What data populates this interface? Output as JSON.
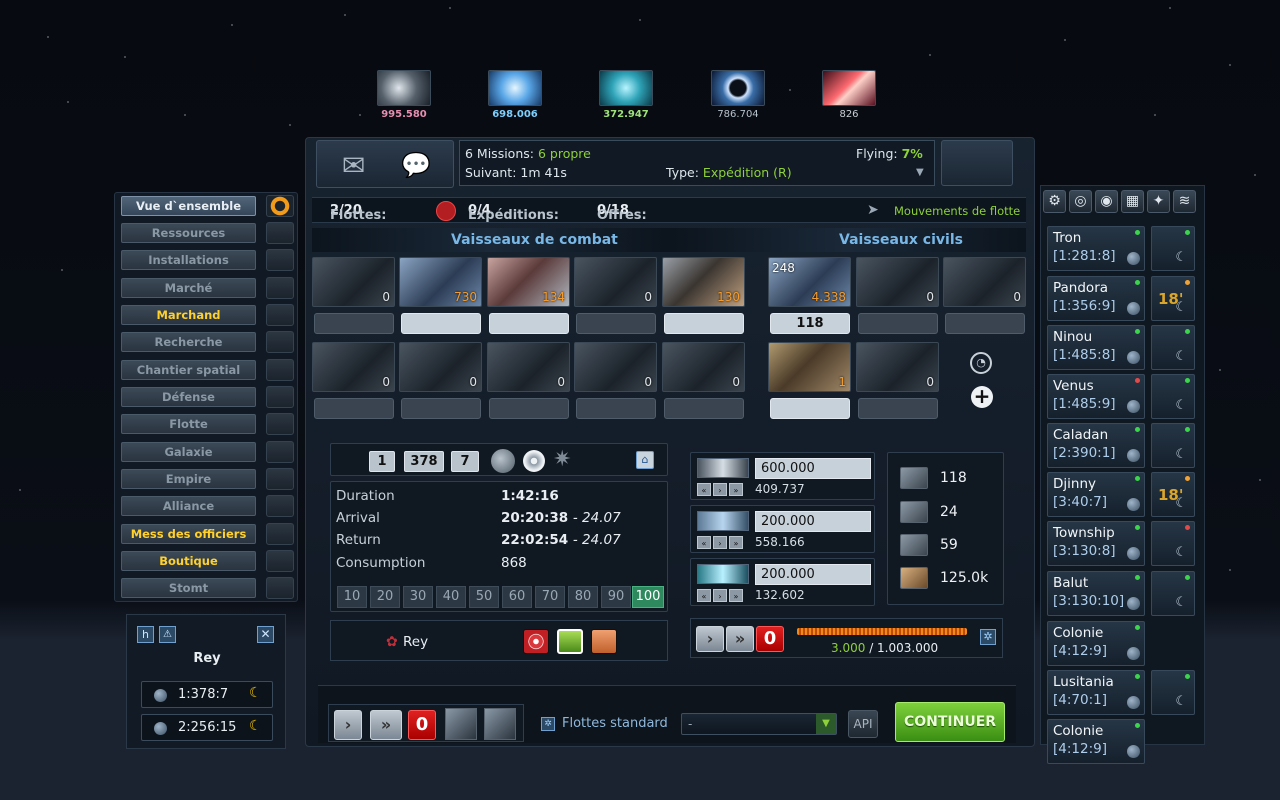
{
  "resources": [
    {
      "icon": "metal-resource-icon",
      "value": "995.580",
      "color": "#e78fb0"
    },
    {
      "icon": "crystal-resource-icon",
      "value": "698.006",
      "color": "#7ed0ff"
    },
    {
      "icon": "deuterium-resource-icon",
      "value": "372.947",
      "color": "#9fe27a"
    },
    {
      "icon": "energy-resource-icon",
      "value": "786.704",
      "color": "#b8c2cc"
    },
    {
      "icon": "dark-matter-resource-icon",
      "value": "826",
      "color": "#c8cfd6"
    }
  ],
  "mission": {
    "count": "6 Missions:",
    "own": "6 propre",
    "next_label": "Suivant:",
    "next_value": "1m 41s",
    "flying_label": "Flying:",
    "flying_value": "7%",
    "type_label": "Type:",
    "type_value": "Expédition (R)"
  },
  "fleetbar": {
    "fleets_label": "Flottes:",
    "fleets_value": "2/20",
    "exp_label": "Expéditions:",
    "exp_value": "0/4",
    "offers_label": "Offres:",
    "offers_value": "0/18",
    "movements": "Mouvements de flotte"
  },
  "menu": [
    {
      "label": "Vue d`ensemble"
    },
    {
      "label": "Ressources"
    },
    {
      "label": "Installations"
    },
    {
      "label": "Marché"
    },
    {
      "label": "Marchand"
    },
    {
      "label": "Recherche"
    },
    {
      "label": "Chantier spatial"
    },
    {
      "label": "Défense"
    },
    {
      "label": "Flotte"
    },
    {
      "label": "Galaxie"
    },
    {
      "label": "Empire"
    },
    {
      "label": "Alliance"
    },
    {
      "label": "Mess des officiers"
    },
    {
      "label": "Boutique"
    },
    {
      "label": "Stomt"
    }
  ],
  "sections": {
    "combat": "Vaisseaux de combat",
    "civil": "Vaisseaux civils"
  },
  "combat_ships": [
    {
      "count": "0",
      "input": ""
    },
    {
      "count": "730",
      "input": ""
    },
    {
      "count": "134",
      "input": ""
    },
    {
      "count": "0",
      "input": ""
    },
    {
      "count": "130",
      "input": ""
    },
    {
      "count": "0",
      "input": ""
    },
    {
      "count": "0",
      "input": ""
    },
    {
      "count": "0",
      "input": ""
    },
    {
      "count": "0",
      "input": ""
    },
    {
      "count": "0",
      "input": ""
    }
  ],
  "civil_ships": [
    {
      "count": "4.338",
      "corner": "248",
      "input": "118"
    },
    {
      "count": "0",
      "input": ""
    },
    {
      "count": "0",
      "input": ""
    },
    {
      "count": "1",
      "input": ""
    },
    {
      "count": "0",
      "input": ""
    }
  ],
  "coords": {
    "galaxy": "1",
    "system": "378",
    "position": "7"
  },
  "info": {
    "duration_label": "Duration",
    "duration_value": "1:42:16",
    "arrival_label": "Arrival",
    "arrival_time": "20:20:38",
    "arrival_date": "24.07",
    "return_label": "Return",
    "return_time": "22:02:54",
    "return_date": "24.07",
    "consumption_label": "Consumption",
    "consumption_value": "868"
  },
  "speeds": [
    "10",
    "20",
    "30",
    "40",
    "50",
    "60",
    "70",
    "80",
    "90",
    "100"
  ],
  "target_player": "Rey",
  "cargo": [
    {
      "value": "600.000",
      "rest": "409.737"
    },
    {
      "value": "200.000",
      "rest": "558.166"
    },
    {
      "value": "200.000",
      "rest": "132.602"
    }
  ],
  "stock": [
    "118",
    "24",
    "59",
    "125.0k"
  ],
  "load": {
    "used": "3.000",
    "total": "/ 1.003.000"
  },
  "bottom": {
    "standard": "Flottes standard",
    "select": "-",
    "api": "API",
    "continue": "CONTINUER"
  },
  "left_box": {
    "h": "h",
    "name": "Rey",
    "planets": [
      "1:378:7",
      "2:256:15"
    ]
  },
  "planets": [
    {
      "name": "Tron",
      "coord": "[1:281:8]",
      "dot": "g",
      "moon": true,
      "timer": ""
    },
    {
      "name": "Pandora",
      "coord": "[1:356:9]",
      "dot": "g",
      "moon": true,
      "timer": "18'"
    },
    {
      "name": "Ninou",
      "coord": "[1:485:8]",
      "dot": "g",
      "moon": true,
      "timer": ""
    },
    {
      "name": "Venus",
      "coord": "[1:485:9]",
      "dot": "r",
      "moon": true,
      "timer": ""
    },
    {
      "name": "Caladan",
      "coord": "[2:390:1]",
      "dot": "g",
      "moon": true,
      "timer": ""
    },
    {
      "name": "Djinny",
      "coord": "[3:40:7]",
      "dot": "g",
      "moon": true,
      "timer": "18'"
    },
    {
      "name": "Township",
      "coord": "[3:130:8]",
      "dot": "g",
      "moon": true,
      "timer": ""
    },
    {
      "name": "Balut",
      "coord": "[3:130:10]",
      "dot": "g",
      "moon": true,
      "timer": ""
    },
    {
      "name": "Colonie",
      "coord": "[4:12:9]",
      "dot": "g",
      "moon": false,
      "timer": ""
    },
    {
      "name": "Lusitania",
      "coord": "[4:70:1]",
      "dot": "g",
      "moon": true,
      "timer": ""
    },
    {
      "name": "Colonie",
      "coord": "[4:12:9]",
      "dot": "g",
      "moon": false,
      "timer": ""
    }
  ]
}
